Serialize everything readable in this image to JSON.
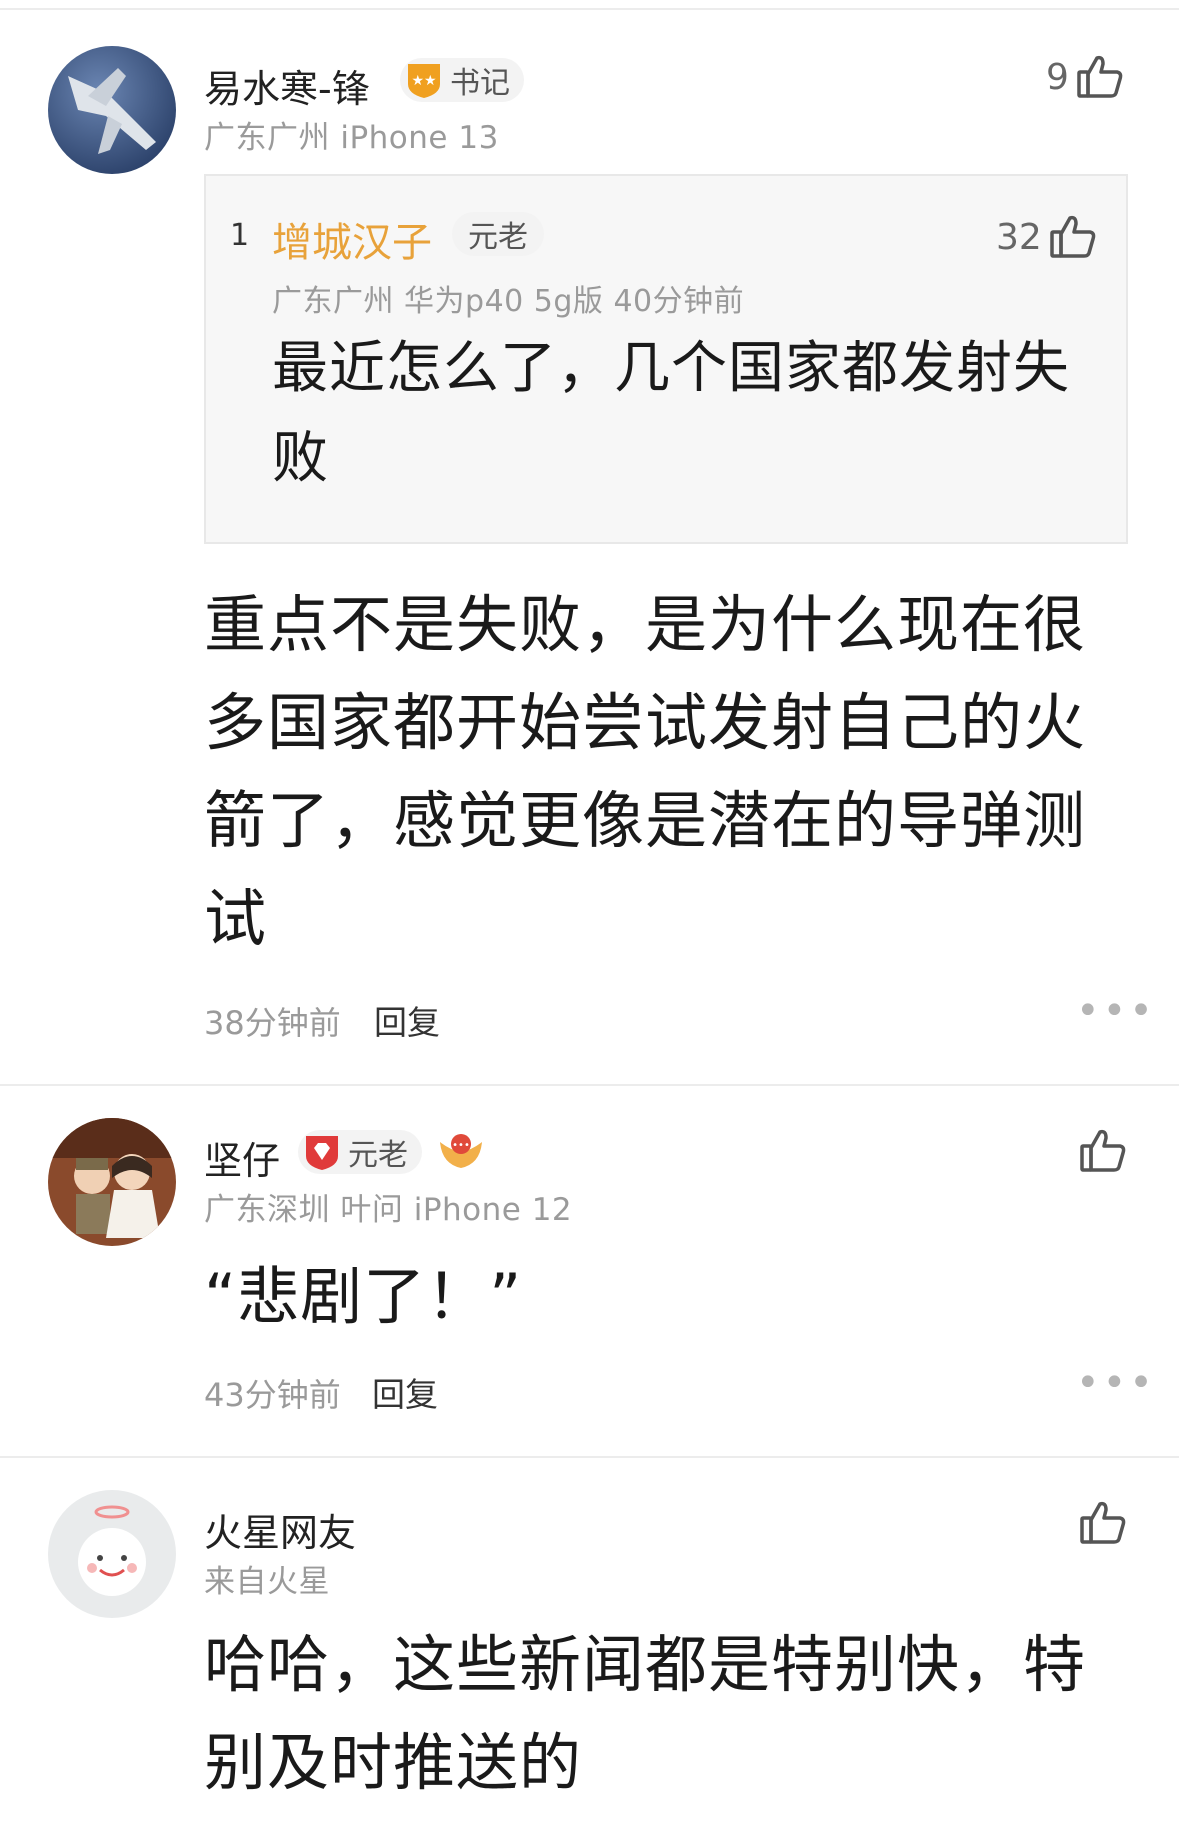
{
  "comments": [
    {
      "username": "易水寒-锋",
      "badge": "书记",
      "meta": "广东广州  iPhone 13",
      "likes": "9",
      "quote": {
        "index": "1",
        "username": "增城汉子",
        "badge": "元老",
        "meta": "广东广州  华为p40 5g版  40分钟前",
        "likes": "32",
        "text": "最近怎么了，几个国家都发射失败"
      },
      "text": "重点不是失败，是为什么现在很多国家都开始尝试发射自己的火箭了，感觉更像是潜在的导弹测试",
      "time": "38分钟前",
      "reply": "回复"
    },
    {
      "username": "坚仔",
      "badge": "元老",
      "meta": "广东深圳  叶问  iPhone 12",
      "text": "“悲剧了！”",
      "time": "43分钟前",
      "reply": "回复"
    },
    {
      "username": "火星网友",
      "meta": "来自火星",
      "text": "哈哈，这些新闻都是特别快，特别及时推送的"
    }
  ],
  "icons": {
    "like": "thumbs-up-icon",
    "more": "more-dots-icon",
    "rank_badge_1": "star-shield-icon",
    "rank_badge_2": "red-diamond-icon",
    "wings_badge": "wings-emblem-icon"
  },
  "colors": {
    "quote_username": "#e8a23a",
    "meta_gray": "#9a9a9a",
    "badge_bg": "#f3f3f3"
  }
}
